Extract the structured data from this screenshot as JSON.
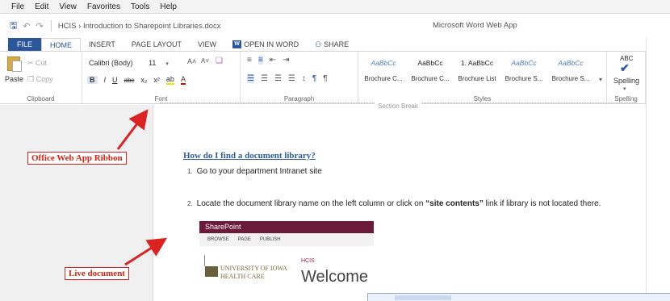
{
  "menubar": [
    "File",
    "Edit",
    "View",
    "Favorites",
    "Tools",
    "Help"
  ],
  "titlebar": {
    "breadcrumb": "HCIS › Introduction to Sharepoint Libraries.docx",
    "app_title": "Microsoft Word Web App"
  },
  "tabs": {
    "file": "FILE",
    "home": "HOME",
    "insert": "INSERT",
    "page_layout": "PAGE LAYOUT",
    "view": "VIEW",
    "open_in_word": "OPEN IN WORD",
    "share": "SHARE"
  },
  "ribbon": {
    "clipboard": {
      "paste": "Paste",
      "cut": "Cut",
      "copy": "Copy",
      "label": "Clipboard"
    },
    "font": {
      "name": "Calibri (Body)",
      "size": "11",
      "label": "Font",
      "grow": "A˄",
      "shrink": "A˅",
      "clear": "Aa",
      "bold": "B",
      "italic": "I",
      "underline": "U",
      "strike": "abc",
      "sub": "x₂",
      "sup": "x²",
      "highlight": "ab",
      "font_color": "A"
    },
    "paragraph": {
      "label": "Paragraph"
    },
    "styles": {
      "label": "Styles",
      "items": [
        {
          "preview": "AaBbCc",
          "name": "Brochure C...",
          "color": "#4f81bd"
        },
        {
          "preview": "AaBbCc",
          "name": "Brochure C...",
          "color": "#222222"
        },
        {
          "preview": "1. AaBbCc",
          "name": "Brochure List",
          "color": "#222222"
        },
        {
          "preview": "AaBbCc",
          "name": "Brochure S...",
          "color": "#4f81bd"
        },
        {
          "preview": "AaBbCc",
          "name": "Brochure S...",
          "color": "#4f81bd"
        }
      ]
    },
    "spelling": {
      "abc": "ABC",
      "label": "Spelling"
    }
  },
  "document": {
    "section_break": "Section Break",
    "heading": "How do I find a document library?",
    "step1_num": "1.",
    "step1": "Go to your department Intranet site",
    "step2_num": "2.",
    "step2_pre": "Locate the document library name on the left column or click on ",
    "step2_bold": "“site contents”",
    "step2_post": " link if library is not located there."
  },
  "sharepoint_image": {
    "brand": "SharePoint",
    "nav": [
      "BROWSE",
      "PAGE",
      "PUBLISH"
    ],
    "logo_line1": "UNIVERSITY OF IOWA",
    "logo_line2": "HEALTH CARE",
    "site": "HCIS",
    "welcome": "Welcome"
  },
  "callouts": {
    "ribbon": "Office Web App Ribbon",
    "document": "Live document"
  },
  "colors": {
    "accent": "#2b579a",
    "callout_red": "#dd2222",
    "sharepoint_maroon": "#6b1a3a"
  }
}
